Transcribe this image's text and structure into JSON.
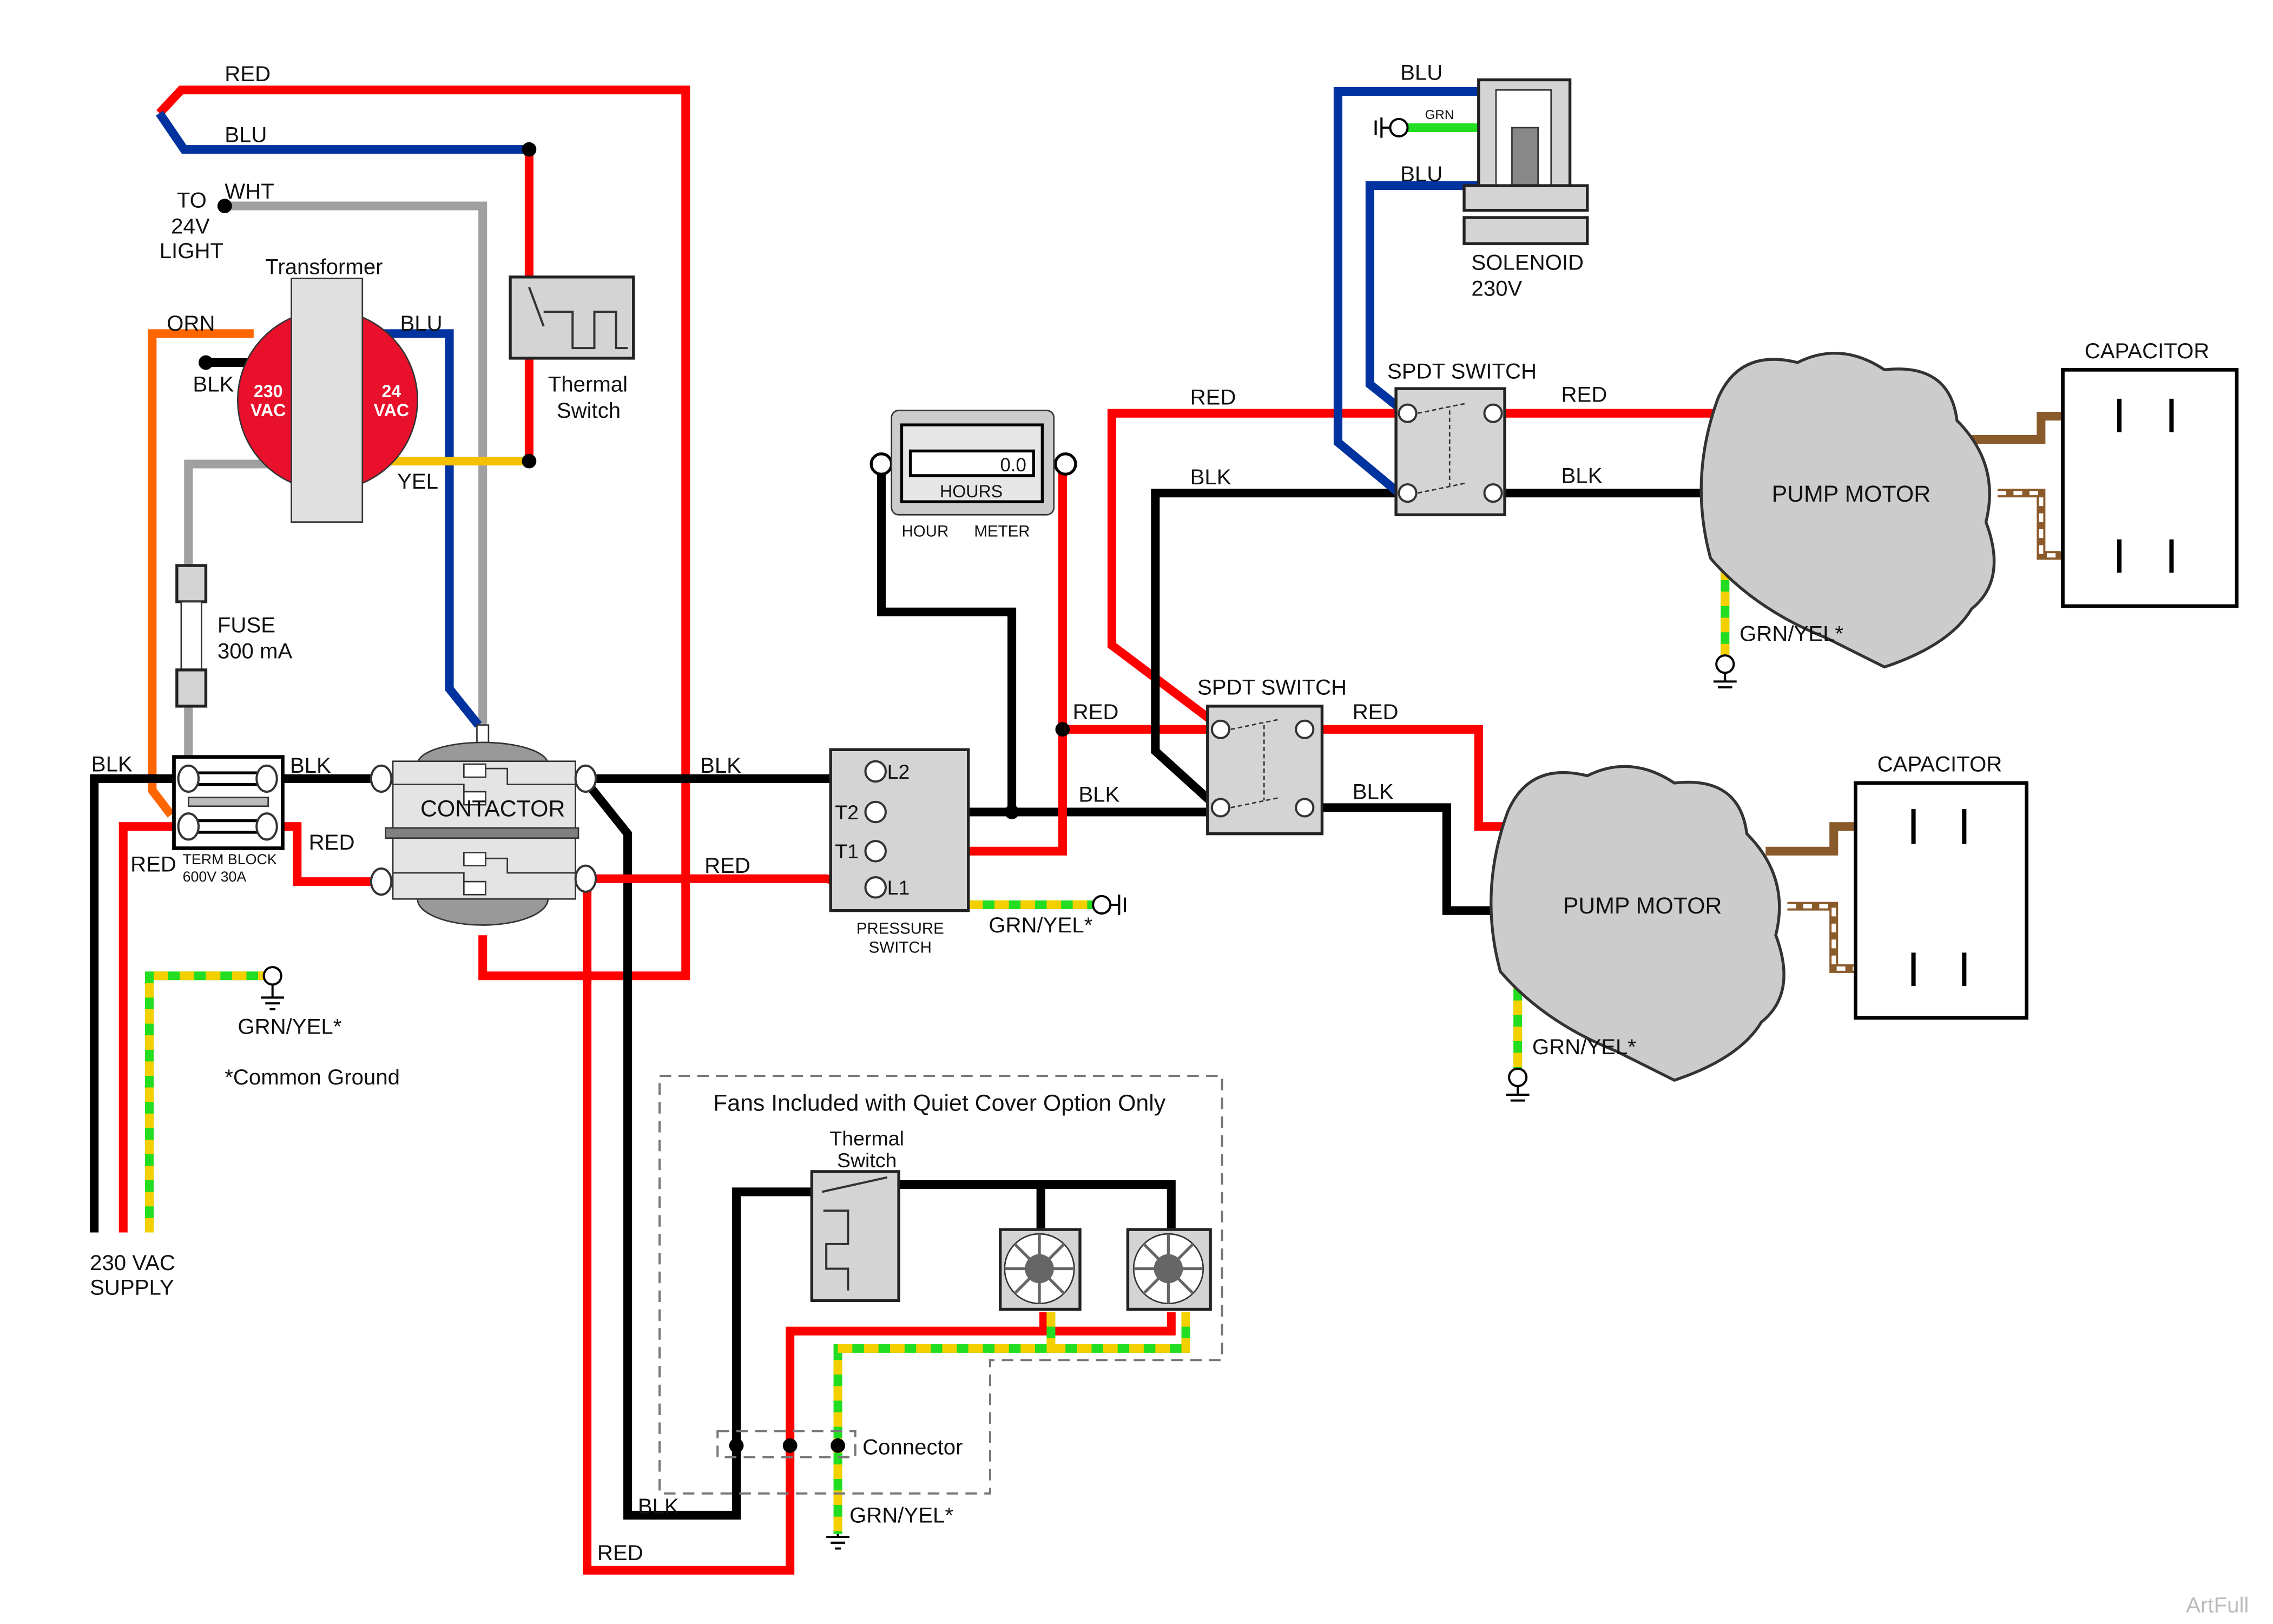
{
  "colors": {
    "black": "#000000",
    "red": "#ff0000",
    "blue": "#0033a0",
    "white_wire": "#a0a0a0",
    "orange": "#ff6600",
    "yellow": "#f5c000",
    "green": "#22dd22",
    "brown": "#8b5a2b",
    "transformer": "#e8102a",
    "component": "#d4d4d4"
  },
  "wire_labels": {
    "red_top": "RED",
    "blu_top": "BLU",
    "wht": "WHT",
    "orn": "ORN",
    "blk_tr": "BLK",
    "blu_tr": "BLU",
    "yel": "YEL",
    "blk_in": "BLK",
    "blk_tb": "BLK",
    "red_tb": "RED",
    "red_in": "RED",
    "blk_ct": "BLK",
    "red_ct": "RED",
    "blk_t2": "BLK",
    "red_t1": "RED",
    "red_sw1": "RED",
    "blk_sw1": "BLK",
    "red_m1": "RED",
    "blk_m1": "BLK",
    "red_sw2": "RED",
    "blk_sw2": "BLK",
    "blu_sol1": "BLU",
    "blu_sol2": "BLU",
    "grn_sol": "GRN",
    "blk_fan": "BLK",
    "red_fan": "RED"
  },
  "components": {
    "light": [
      "TO",
      "24V",
      "LIGHT"
    ],
    "transformer": {
      "title": "Transformer",
      "primary": [
        "230",
        "VAC"
      ],
      "secondary": [
        "24",
        "VAC"
      ]
    },
    "thermal_switch": [
      "Thermal",
      "Switch"
    ],
    "fuse": [
      "FUSE",
      "300 mA"
    ],
    "term_block": [
      "TERM BLOCK",
      "600V 30A"
    ],
    "contactor": "CONTACTOR",
    "hour_meter": {
      "display": "0.0",
      "unit": "HOURS",
      "label1": "HOUR",
      "label2": "METER"
    },
    "pressure_switch": {
      "terminals": [
        "L2",
        "T2",
        "T1",
        "L1"
      ],
      "label": [
        "PRESSURE",
        "SWITCH"
      ]
    },
    "spdt1": "SPDT SWITCH",
    "spdt2": "SPDT SWITCH",
    "solenoid": [
      "SOLENOID",
      "230V"
    ],
    "pump1": "PUMP MOTOR",
    "pump2": "PUMP MOTOR",
    "cap1": "CAPACITOR",
    "cap2": "CAPACITOR",
    "supply": [
      "230 VAC",
      "SUPPLY"
    ],
    "fans_box": "Fans Included with Quiet Cover Option Only",
    "fan_thermal": [
      "Thermal",
      "Switch"
    ],
    "connector": "Connector"
  },
  "grounds": {
    "main": "GRN/YEL*",
    "ps": "GRN/YEL*",
    "m1": "GRN/YEL*",
    "m2": "GRN/YEL*",
    "fan": "GRN/YEL*"
  },
  "note": "*Common Ground",
  "watermark": "ArtFull"
}
